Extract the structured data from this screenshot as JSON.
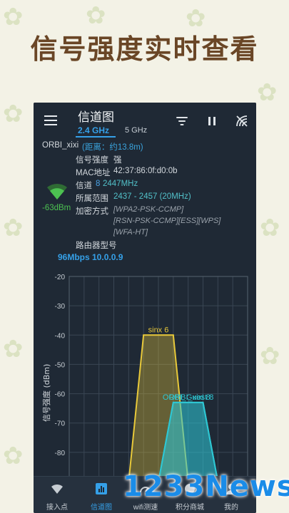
{
  "banner": {
    "title": "信号强度实时查看"
  },
  "app": {
    "title": "信道图",
    "bands": [
      "2.4 GHz",
      "5 GHz"
    ],
    "active_band": "2.4 GHz"
  },
  "toolbar_icons": [
    "filter-icon",
    "pause-icon",
    "signal-scan-icon"
  ],
  "network": {
    "ssid": "ORBI_xixi",
    "distance": "(距离：约13.8m)",
    "strength_label": "信号强度",
    "strength_value": "强",
    "mac_label": "MAC地址",
    "mac_value": "42:37:86:0f:d0:0b",
    "channel_label": "信道",
    "channel_number": "8",
    "channel_freq": "2447MHz",
    "range_label": "所属范围",
    "range_value": "2437 - 2457 (20MHz)",
    "enc_label": "加密方式",
    "enc_lines": [
      "[WPA2-PSK-CCMP]",
      "[RSN-PSK-CCMP][ESS][WPS]",
      "[WFA-HT]"
    ],
    "router_label": "路由器型号",
    "speed": "96Mbps 10.0.0.9",
    "dbm": "-63dBm"
  },
  "chart_data": {
    "type": "area",
    "ylabel": "信号强度 (dBm)",
    "yticks": [
      "-20",
      "-30",
      "-40",
      "-50",
      "-60",
      "-70",
      "-80"
    ],
    "ylim": [
      -90,
      -20
    ],
    "series": [
      {
        "name": "sinx 6",
        "x_range": [
          4,
          8
        ],
        "value": -40,
        "color": "#e8c93a"
      },
      {
        "name": "ORBI_Guest 8",
        "x_range": [
          6,
          10
        ],
        "value": -63,
        "color": "#2ec7d3"
      },
      {
        "name": "ORBI_xixi 8",
        "x_range": [
          6,
          10
        ],
        "value": -63,
        "color": "#2ec7d3"
      }
    ],
    "x_grid_count": 13
  },
  "tabs": [
    {
      "label": "接入点",
      "icon": "wifi-icon"
    },
    {
      "label": "信道图",
      "icon": "bar-chart-icon"
    },
    {
      "label": "wifi测速",
      "icon": "speedometer-icon"
    },
    {
      "label": "积分商城",
      "icon": "store-icon"
    },
    {
      "label": "我的",
      "icon": "profile-icon"
    }
  ],
  "active_tab": "信道图",
  "watermark": "1233News"
}
